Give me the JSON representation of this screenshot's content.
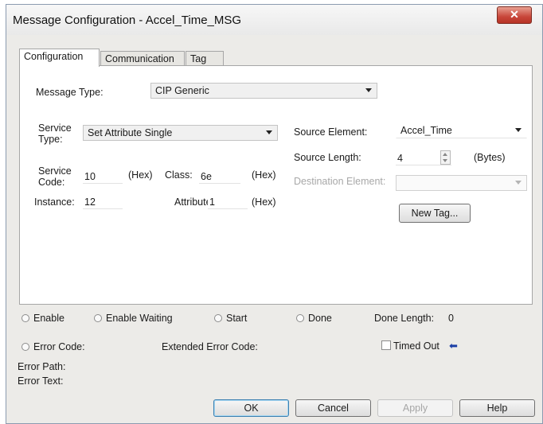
{
  "window": {
    "title": "Message Configuration - Accel_Time_MSG",
    "close_glyph": "✕"
  },
  "tabs": [
    {
      "label": "Configuration",
      "active": true
    },
    {
      "label": "Communication",
      "active": false
    },
    {
      "label": "Tag",
      "active": false
    }
  ],
  "config": {
    "message_type_label": "Message Type:",
    "message_type_value": "CIP Generic",
    "service_type_label": "Service Type:",
    "service_type_value": "Set Attribute Single",
    "service_code_label": "Service Code:",
    "service_code_value": "10",
    "service_code_unit": "(Hex)",
    "class_label": "Class:",
    "class_value": "6e",
    "class_unit": "(Hex)",
    "instance_label": "Instance:",
    "instance_value": "12",
    "attribute_label": "Attribute:",
    "attribute_value": "1",
    "attribute_unit": "(Hex)",
    "source_element_label": "Source Element:",
    "source_element_value": "Accel_Time",
    "source_length_label": "Source Length:",
    "source_length_value": "4",
    "source_length_unit": "(Bytes)",
    "destination_element_label": "Destination Element:",
    "destination_element_value": "",
    "new_tag_label": "New Tag..."
  },
  "status": {
    "enable": "Enable",
    "enable_waiting": "Enable Waiting",
    "start": "Start",
    "done": "Done",
    "done_length_label": "Done Length:",
    "done_length_value": "0",
    "error_code_label": "Error Code:",
    "extended_error_code_label": "Extended Error Code:",
    "timed_out_label": "Timed Out",
    "timed_out_arrow": "⬅",
    "error_path_label": "Error Path:",
    "error_text_label": "Error Text:"
  },
  "buttons": {
    "ok": "OK",
    "cancel": "Cancel",
    "apply": "Apply",
    "help": "Help"
  },
  "colors": {
    "accent_blue": "#1b3fa6",
    "close_red": "#c8463a"
  }
}
